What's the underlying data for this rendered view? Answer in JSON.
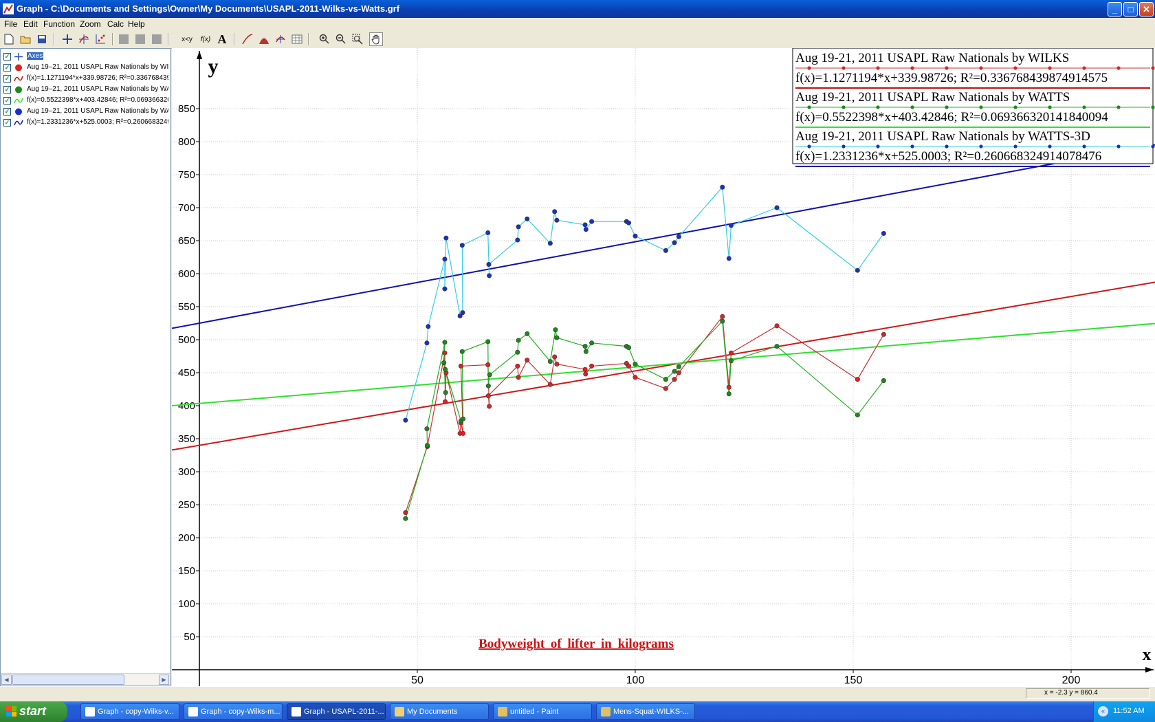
{
  "window": {
    "title": "Graph - C:\\Documents and Settings\\Owner\\My Documents\\USAPL-2011-Wilks-vs-Watts.grf",
    "controls": {
      "minimize": "_",
      "maximize": "□",
      "close": "✕"
    }
  },
  "menu": [
    "File",
    "Edit",
    "Function",
    "Zoom",
    "Calc",
    "Help"
  ],
  "toolbar": {
    "xy_label": "x<y",
    "fx_label": "f(x)",
    "text_label": "A"
  },
  "function_list": [
    {
      "label": "Axes",
      "icon": "axes-icon",
      "color": "#2050c0",
      "selected": true
    },
    {
      "label": "Aug 19–21, 2011 USAPL Raw Nationals by WILKS",
      "icon": "point-series-icon",
      "color": "#e02020"
    },
    {
      "label": "f(x)=1.1271194*x+339.98726; R²=0.336768439874914575",
      "icon": "trendline-icon",
      "color": "#c01010"
    },
    {
      "label": "Aug 19–21, 2011 USAPL Raw Nationals by WATTS",
      "icon": "point-series-icon",
      "color": "#1a8a1a"
    },
    {
      "label": "f(x)=0.5522398*x+403.42846; R²=0.0693663201418400094",
      "icon": "trendline-icon",
      "color": "#30e030"
    },
    {
      "label": "Aug 19–21, 2011 USAPL Raw Nationals by WATTS-3D",
      "icon": "point-series-icon",
      "color": "#1a30c8"
    },
    {
      "label": "f(x)=1.2331236*x+525.0003; R²=0.260668324914078476",
      "icon": "trendline-icon",
      "color": "#1010b0"
    }
  ],
  "legend": [
    {
      "series": "Aug 19-21, 2011 USAPL Raw Nationals by WILKS",
      "trend": "f(x)=1.1271194*x+339.98726; R²=0.336768439874914575",
      "series_color": "#c83030",
      "marker_color": "#e02020",
      "trend_color": "#c01010"
    },
    {
      "series": "Aug 19-21, 2011 USAPL Raw Nationals by WATTS",
      "trend": "f(x)=0.5522398*x+403.42846; R²=0.069366320141840094",
      "series_color": "#20b020",
      "marker_color": "#1a8a1a",
      "trend_color": "#30e030"
    },
    {
      "series": "Aug 19-21, 2011 USAPL Raw Nationals by WATTS-3D",
      "trend": "f(x)=1.2331236*x+525.0003; R²=0.260668324914078476",
      "series_color": "#30d0e0",
      "marker_color": "#1a30c8",
      "trend_color": "#1010b0"
    }
  ],
  "chart_data": {
    "type": "scatter",
    "xlabel": "x",
    "ylabel": "y",
    "xlim": [
      -6,
      219
    ],
    "ylim": [
      0,
      880
    ],
    "x_ticks": [
      50,
      100,
      150,
      200
    ],
    "y_ticks": [
      50,
      100,
      150,
      200,
      250,
      300,
      350,
      400,
      450,
      500,
      550,
      600,
      650,
      700,
      750,
      800,
      850
    ],
    "grid": true,
    "annotation": "Bodyweight of lifter in kilograms",
    "series": [
      {
        "name": "Aug 19-21, 2011 USAPL Raw Nationals by WILKS",
        "line_color": "#c83030",
        "marker_color": "#e02020",
        "points": [
          [
            47.3,
            238
          ],
          [
            52.3,
            338
          ],
          [
            56.3,
            480
          ],
          [
            56.4,
            406
          ],
          [
            56.6,
            450
          ],
          [
            59.8,
            358
          ],
          [
            60,
            374
          ],
          [
            60.5,
            358
          ],
          [
            60,
            460
          ],
          [
            66.2,
            462
          ],
          [
            66.5,
            399
          ],
          [
            66.3,
            415
          ],
          [
            73,
            460
          ],
          [
            73.2,
            443
          ],
          [
            75.2,
            469
          ],
          [
            80.5,
            432
          ],
          [
            81.5,
            474
          ],
          [
            82,
            463
          ],
          [
            88.5,
            455
          ],
          [
            88.6,
            448
          ],
          [
            90,
            460
          ],
          [
            98,
            464
          ],
          [
            98.5,
            460
          ],
          [
            100,
            443
          ],
          [
            107,
            426
          ],
          [
            109,
            440
          ],
          [
            110,
            450
          ],
          [
            120,
            535
          ],
          [
            121.5,
            428
          ],
          [
            122,
            480
          ],
          [
            132.5,
            521
          ],
          [
            151,
            440
          ],
          [
            157,
            508
          ]
        ]
      },
      {
        "name": "Aug 19-21, 2011 USAPL Raw Nationals by WATTS",
        "line_color": "#20b020",
        "marker_color": "#1a8a1a",
        "points": [
          [
            47.3,
            229
          ],
          [
            52.3,
            340
          ],
          [
            52.2,
            365
          ],
          [
            56.3,
            496
          ],
          [
            56.1,
            465
          ],
          [
            56.5,
            420
          ],
          [
            56.4,
            455
          ],
          [
            60,
            377
          ],
          [
            60.5,
            380
          ],
          [
            60.3,
            482
          ],
          [
            66.2,
            497
          ],
          [
            66.3,
            430
          ],
          [
            66.6,
            447
          ],
          [
            73,
            481
          ],
          [
            73.2,
            499
          ],
          [
            75.2,
            509
          ],
          [
            80.5,
            467
          ],
          [
            81.7,
            515
          ],
          [
            82,
            503
          ],
          [
            88.5,
            490
          ],
          [
            88.7,
            482
          ],
          [
            90,
            495
          ],
          [
            98,
            490
          ],
          [
            98.5,
            488
          ],
          [
            100,
            463
          ],
          [
            107,
            440
          ],
          [
            109,
            452
          ],
          [
            110,
            459
          ],
          [
            120,
            528
          ],
          [
            121.5,
            418
          ],
          [
            122,
            468
          ],
          [
            132.5,
            490
          ],
          [
            151,
            386
          ],
          [
            157,
            438
          ]
        ]
      },
      {
        "name": "Aug 19-21, 2011 USAPL Raw Nationals by WATTS-3D",
        "line_color": "#30d0e0",
        "marker_color": "#1a30c8",
        "points": [
          [
            47.3,
            378
          ],
          [
            52.2,
            495
          ],
          [
            52.5,
            520
          ],
          [
            56.3,
            622
          ],
          [
            56.3,
            577
          ],
          [
            56.6,
            654
          ],
          [
            59.8,
            536
          ],
          [
            60.4,
            541
          ],
          [
            60.3,
            643
          ],
          [
            66.2,
            662
          ],
          [
            66.5,
            597
          ],
          [
            66.4,
            614
          ],
          [
            73,
            651
          ],
          [
            73.2,
            671
          ],
          [
            75.2,
            683
          ],
          [
            80.5,
            646
          ],
          [
            81.5,
            694
          ],
          [
            82,
            681
          ],
          [
            88.5,
            674
          ],
          [
            88.7,
            667
          ],
          [
            90,
            679
          ],
          [
            98,
            679
          ],
          [
            98.5,
            677
          ],
          [
            100,
            657
          ],
          [
            107,
            635
          ],
          [
            109,
            647
          ],
          [
            110,
            656
          ],
          [
            120,
            731
          ],
          [
            121.5,
            623
          ],
          [
            122,
            673
          ],
          [
            132.5,
            700
          ],
          [
            151,
            605
          ],
          [
            157,
            661
          ]
        ]
      }
    ],
    "trendlines": [
      {
        "name": "f(x)=1.1271194*x+339.98726; R²=0.336768439874914575",
        "slope": 1.1271194,
        "intercept": 339.98726,
        "color": "#d01818"
      },
      {
        "name": "f(x)=0.5522398*x+403.42846; R²=0.069366320141840094",
        "slope": 0.5522398,
        "intercept": 403.42846,
        "color": "#30e030"
      },
      {
        "name": "f(x)=1.2331236*x+525.0003; R²=0.260668324914078476",
        "slope": 1.2331236,
        "intercept": 525.0003,
        "color": "#1010b0"
      }
    ]
  },
  "status": {
    "coords": "x = -2.3    y = 860.4"
  },
  "taskbar": {
    "start": "start",
    "tasks": [
      {
        "label": "Graph - copy-Wilks-v...",
        "icon_color": "#ffffff"
      },
      {
        "label": "Graph - copy-Wilks-m...",
        "icon_color": "#ffffff"
      },
      {
        "label": "Graph - USAPL-2011-...",
        "icon_color": "#ffffff",
        "active": true
      },
      {
        "label": "My Documents",
        "icon_color": "#f0d070"
      },
      {
        "label": "untitled - Paint",
        "icon_color": "#e0c060"
      },
      {
        "label": "Mens-Squat-WILKS-...",
        "icon_color": "#e0c060"
      }
    ],
    "clock": "11:52 AM"
  }
}
